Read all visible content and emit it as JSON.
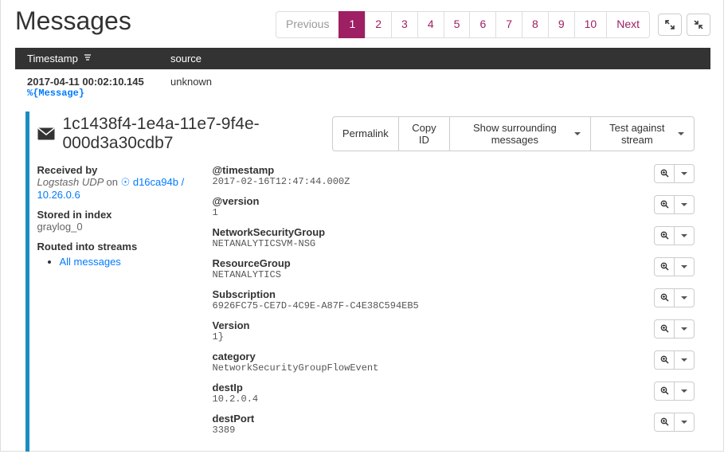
{
  "title": "Messages",
  "pagination": {
    "prev": "Previous",
    "pages": [
      "1",
      "2",
      "3",
      "4",
      "5",
      "6",
      "7",
      "8",
      "9",
      "10"
    ],
    "active": "1",
    "next": "Next"
  },
  "columns": {
    "c0": "Timestamp",
    "c1": "source"
  },
  "row": {
    "timestamp": "2017-04-11 00:02:10.145",
    "source": "unknown",
    "placeholder": "%{Message}"
  },
  "detail": {
    "id": "1c1438f4-1e4a-11e7-9f4e-000d3a30cdb7",
    "buttons": {
      "permalink": "Permalink",
      "copy": "Copy ID",
      "surrounding": "Show surrounding messages",
      "test": "Test against stream"
    },
    "meta": {
      "received_label": "Received by",
      "received_input": "Logstash UDP",
      "received_on": "on",
      "received_node": "d16ca94b / 10.26.0.6",
      "stored_label": "Stored in index",
      "stored_value": "graylog_0",
      "routed_label": "Routed into streams",
      "stream_link": "All messages"
    },
    "fields": [
      {
        "name": "@timestamp",
        "value": "2017-02-16T12:47:44.000Z"
      },
      {
        "name": "@version",
        "value": "1"
      },
      {
        "name": "NetworkSecurityGroup",
        "value": "NETANALYTICSVM-NSG"
      },
      {
        "name": "ResourceGroup",
        "value": "NETANALYTICS"
      },
      {
        "name": "Subscription",
        "value": "6926FC75-CE7D-4C9E-A87F-C4E38C594EB5"
      },
      {
        "name": "Version",
        "value": "1}"
      },
      {
        "name": "category",
        "value": "NetworkSecurityGroupFlowEvent"
      },
      {
        "name": "destIp",
        "value": "10.2.0.4"
      },
      {
        "name": "destPort",
        "value": "3389"
      }
    ]
  }
}
